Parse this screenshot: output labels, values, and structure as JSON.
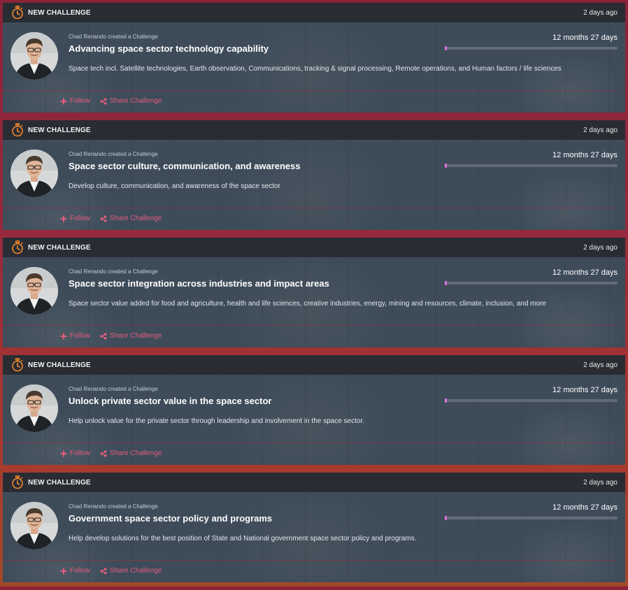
{
  "feed": {
    "items": [
      {
        "header_label": "NEW CHALLENGE",
        "header_time": "2 days ago",
        "creator_line": "Chad Renando created a Challenge",
        "title": "Advancing space sector technology capability",
        "description": "Space tech incl. Satellite technologies, Earth observation, Communications, tracking & signal processing, Remote operations, and Human factors / life sciences",
        "duration": "12 months 27 days",
        "progress": 0.01,
        "follow_label": "Follow",
        "share_label": "Share Challenge"
      },
      {
        "header_label": "NEW CHALLENGE",
        "header_time": "2 days ago",
        "creator_line": "Chad Renando created a Challenge",
        "title": "Space sector culture, communication, and awareness",
        "description": "Develop culture, communication, and awareness of the space sector",
        "duration": "12 months 27 days",
        "progress": 0.01,
        "follow_label": "Follow",
        "share_label": "Share Challenge"
      },
      {
        "header_label": "NEW CHALLENGE",
        "header_time": "2 days ago",
        "creator_line": "Chad Renando created a Challenge",
        "title": "Space sector integration across industries and impact areas",
        "description": "Space sector value added for food and agriculture, health and life sciences, creative industries, energy, mining and resources, climate, inclusion, and more",
        "duration": "12 months 27 days",
        "progress": 0.01,
        "follow_label": "Follow",
        "share_label": "Share Challenge"
      },
      {
        "header_label": "NEW CHALLENGE",
        "header_time": "2 days ago",
        "creator_line": "Chad Renando created a Challenge",
        "title": "Unlock private sector value in the space sector",
        "description": "Help unlock value for the private sector through leadership and involvement in the space sector.",
        "duration": "12 months 27 days",
        "progress": 0.01,
        "follow_label": "Follow",
        "share_label": "Share Challenge"
      },
      {
        "header_label": "NEW CHALLENGE",
        "header_time": "2 days ago",
        "creator_line": "Chad Renando created a Challenge",
        "title": "Government space sector policy and programs",
        "description": "Help develop solutions for the best position of State and National government space sector policy and programs.",
        "duration": "12 months 27 days",
        "progress": 0.01,
        "follow_label": "Follow",
        "share_label": "Share Challenge"
      }
    ]
  },
  "icons": {
    "header": "stopwatch-icon",
    "follow": "plus-icon",
    "share": "share-icon"
  },
  "colors": {
    "accent_orange": "#f0892c",
    "action_pink": "#e45d7d",
    "progress_fill": "#e06ee0",
    "header_bg": "#292c33",
    "page_border": "#8a2238"
  }
}
